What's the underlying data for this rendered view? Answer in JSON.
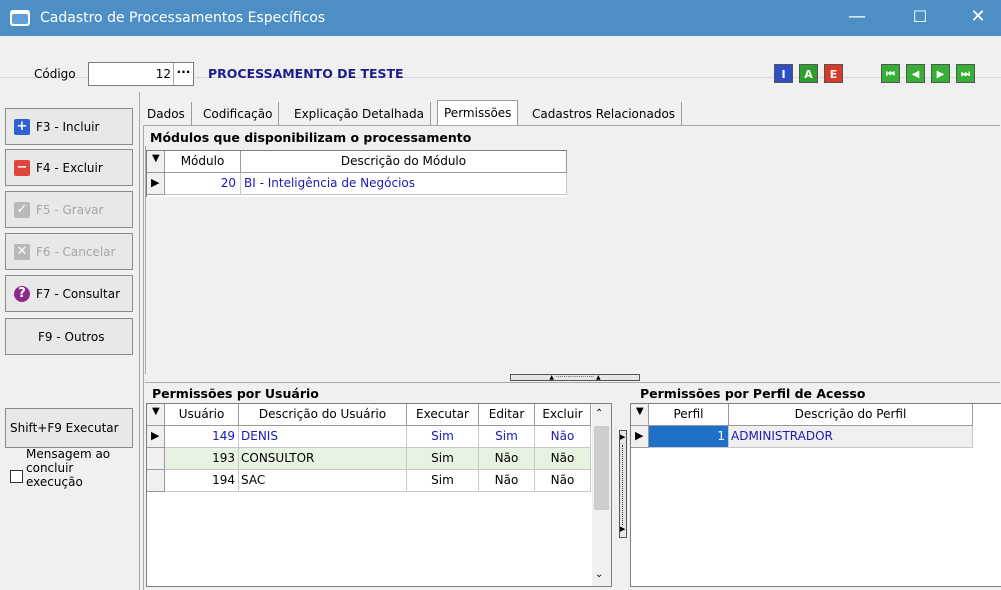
{
  "window": {
    "title": "Cadastro de Processamentos Específicos",
    "minimize": "—",
    "maximize": "☐",
    "close": "✕"
  },
  "codebar": {
    "label": "Código",
    "value": "12",
    "dots": "···",
    "name": "PROCESSAMENTO DE TESTE",
    "buttons": [
      {
        "label": "I",
        "color": "#2f4fc4"
      },
      {
        "label": "A",
        "color": "#2e9e2e"
      },
      {
        "label": "E",
        "color": "#d83a2a"
      }
    ],
    "nav": [
      {
        "label": "⏮",
        "name": "first-record-button"
      },
      {
        "label": "◀",
        "name": "previous-record-button"
      },
      {
        "label": "▶",
        "name": "next-record-button"
      },
      {
        "label": "⏭",
        "name": "last-record-button"
      }
    ],
    "nav_color": "#35b035"
  },
  "sidebar": {
    "buttons": [
      {
        "label": "F3 - Incluir",
        "icon": "+",
        "icon_color": "#2e62d4",
        "disabled": false
      },
      {
        "label": "F4 - Excluir",
        "icon": "−",
        "icon_color": "#e0443a",
        "disabled": false
      },
      {
        "label": "F5 - Gravar",
        "icon": "✓",
        "icon_color": "#b9b9b9",
        "disabled": true
      },
      {
        "label": "F6 - Cancelar",
        "icon": "✕",
        "icon_color": "#b9b9b9",
        "disabled": true
      },
      {
        "label": "F7 - Consultar",
        "icon": "?",
        "icon_color": "#8a2a8a",
        "disabled": false
      },
      {
        "label": "F9 - Outros",
        "icon": "",
        "icon_color": "",
        "disabled": false
      }
    ],
    "execute_label": "Shift+F9 Executar",
    "checkbox_label_1": "Mensagem ao",
    "checkbox_label_2": "concluir",
    "checkbox_label_3": "execução"
  },
  "tabs": [
    "Dados",
    "Codificação",
    "Explicação Detalhada",
    "Permissões",
    "Cadastros Relacionados"
  ],
  "active_tab": "Permissões",
  "modules": {
    "title": "Módulos que disponibilizam o processamento",
    "headers": [
      "Módulo",
      "Descrição do Módulo"
    ],
    "rows": [
      [
        "20",
        "BI - Inteligência de Negócios"
      ]
    ]
  },
  "users": {
    "title": "Permissões por Usuário",
    "headers": [
      "Usuário",
      "Descrição do Usuário",
      "Executar",
      "Editar",
      "Excluir"
    ],
    "rows": [
      [
        "149",
        "DENIS",
        "Sim",
        "Sim",
        "Não"
      ],
      [
        "193",
        "CONSULTOR",
        "Sim",
        "Não",
        "Não"
      ],
      [
        "194",
        "SAC",
        "Sim",
        "Não",
        "Não"
      ]
    ]
  },
  "profiles": {
    "title": "Permissões por Perfil de Acesso",
    "headers": [
      "Perfil",
      "Descrição do Perfil"
    ],
    "rows": [
      [
        "1",
        "ADMINISTRADOR"
      ]
    ]
  }
}
